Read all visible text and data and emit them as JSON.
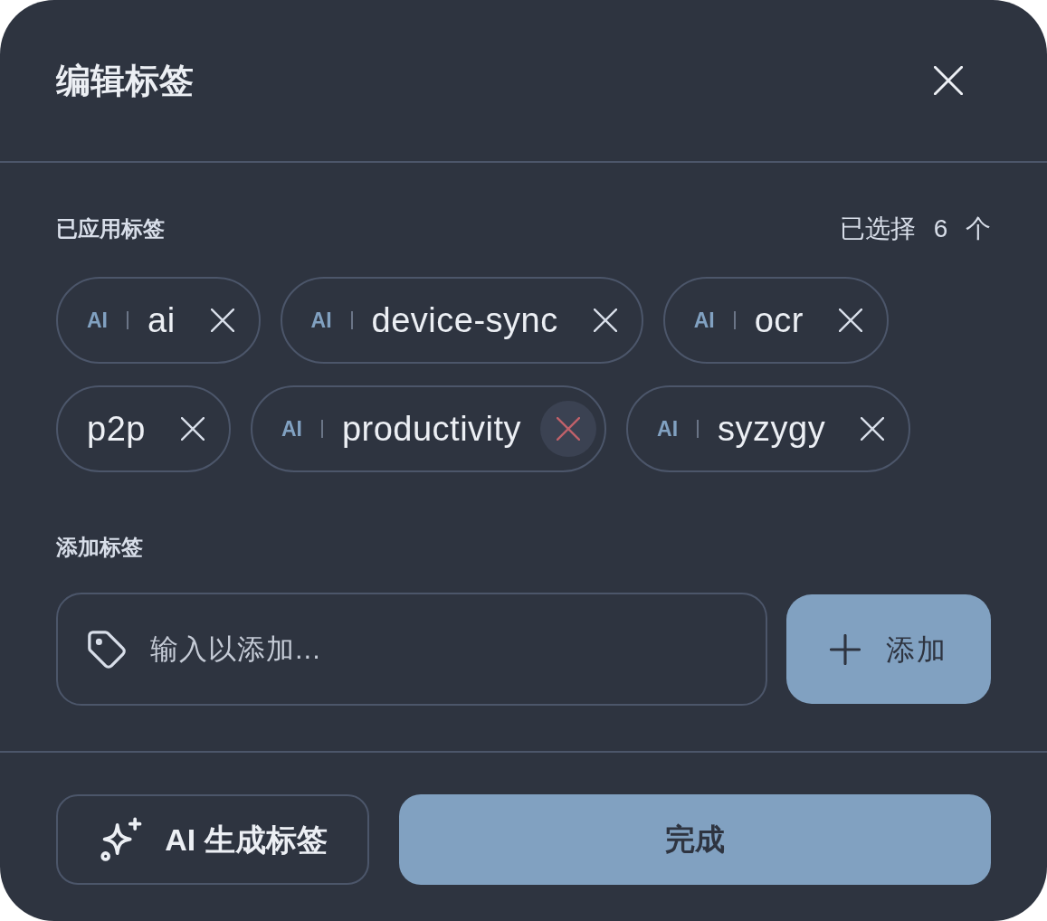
{
  "dialog": {
    "title": "编辑标签"
  },
  "applied": {
    "heading": "已应用标签",
    "count": "已选择 6 个"
  },
  "tags": [
    {
      "badge": "AI",
      "label": "ai",
      "hovered": false
    },
    {
      "badge": "AI",
      "label": "device-sync",
      "hovered": false
    },
    {
      "badge": "AI",
      "label": "ocr",
      "hovered": false
    },
    {
      "label": "p2p",
      "hovered": false
    },
    {
      "badge": "AI",
      "label": "productivity",
      "hovered": true
    },
    {
      "badge": "AI",
      "label": "syzygy",
      "hovered": false
    }
  ],
  "add": {
    "heading": "添加标签",
    "placeholder": "输入以添加...",
    "button": "添加"
  },
  "footer": {
    "ai_button": "AI 生成标签",
    "done_button": "完成"
  }
}
